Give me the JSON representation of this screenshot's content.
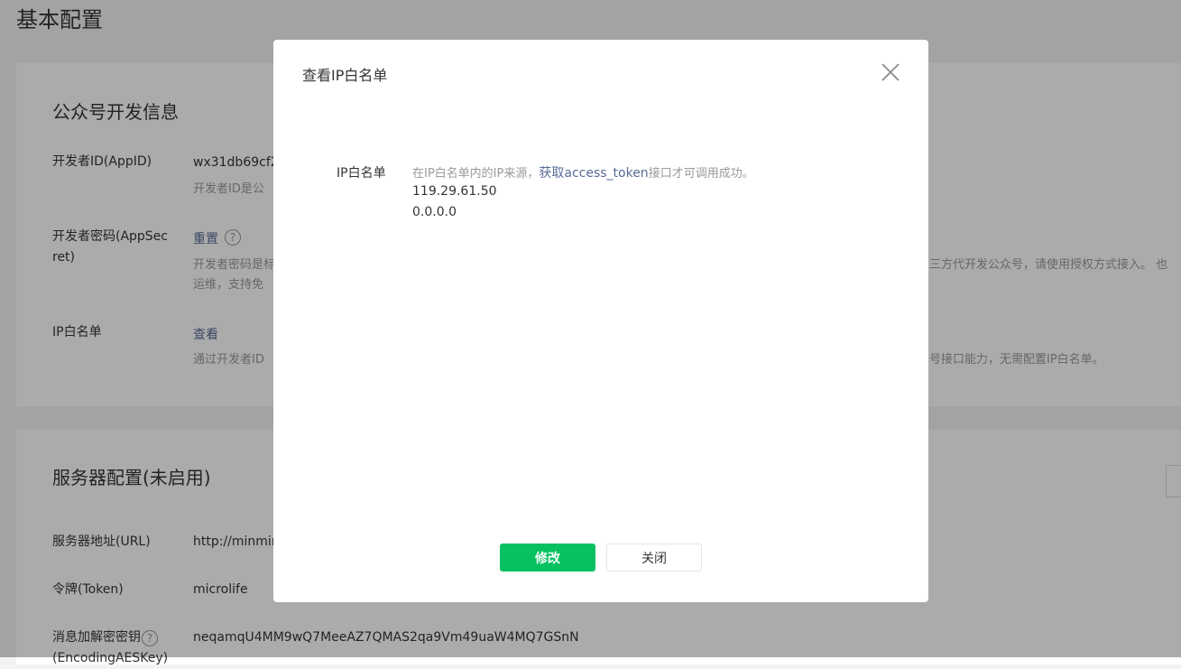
{
  "page": {
    "title": "基本配置"
  },
  "dev_info": {
    "title": "公众号开发信息",
    "appid": {
      "label": "开发者ID(AppID)",
      "value": "wx31db69cf2",
      "desc": "开发者ID是公"
    },
    "secret": {
      "label_line1": "开发者密码(AppSec",
      "label_line2": "ret)",
      "link": "重置",
      "help": "?",
      "desc_line1": "开发者密码是标",
      "desc_line2": "运维，支持免",
      "desc_right": "三方代开发公众号，请使用授权方式接入。 也"
    },
    "ip": {
      "label": "IP白名单",
      "link": "查看",
      "desc": "通过开发者ID",
      "desc_right": "号接口能力，无需配置IP白名单。"
    }
  },
  "server": {
    "title": "服务器配置(未启用)",
    "url": {
      "label": "服务器地址(URL)",
      "value": "http://minmin"
    },
    "token": {
      "label": "令牌(Token)",
      "value": "microlife"
    },
    "aes": {
      "label_line1": "消息加解密密钥",
      "label_line2": "(EncodingAESKey)",
      "help": "?",
      "value": "neqamqU4MM9wQ7MeeAZ7QMAS2qa9Vm49uaW4MQ7GSnN"
    }
  },
  "dialog": {
    "title": "查看IP白名单",
    "label": "IP白名单",
    "desc_pre": "在IP白名单内的IP来源，",
    "desc_link": "获取access_token",
    "desc_post": "接口才可调用成功。",
    "ips": [
      "119.29.61.50",
      "0.0.0.0"
    ],
    "confirm_label": "修改",
    "close_label": "关闭"
  },
  "colors": {
    "primary": "#07c160",
    "link": "#576b95",
    "muted": "#9a9a9a",
    "mask": "rgba(0,0,0,0.33)"
  }
}
